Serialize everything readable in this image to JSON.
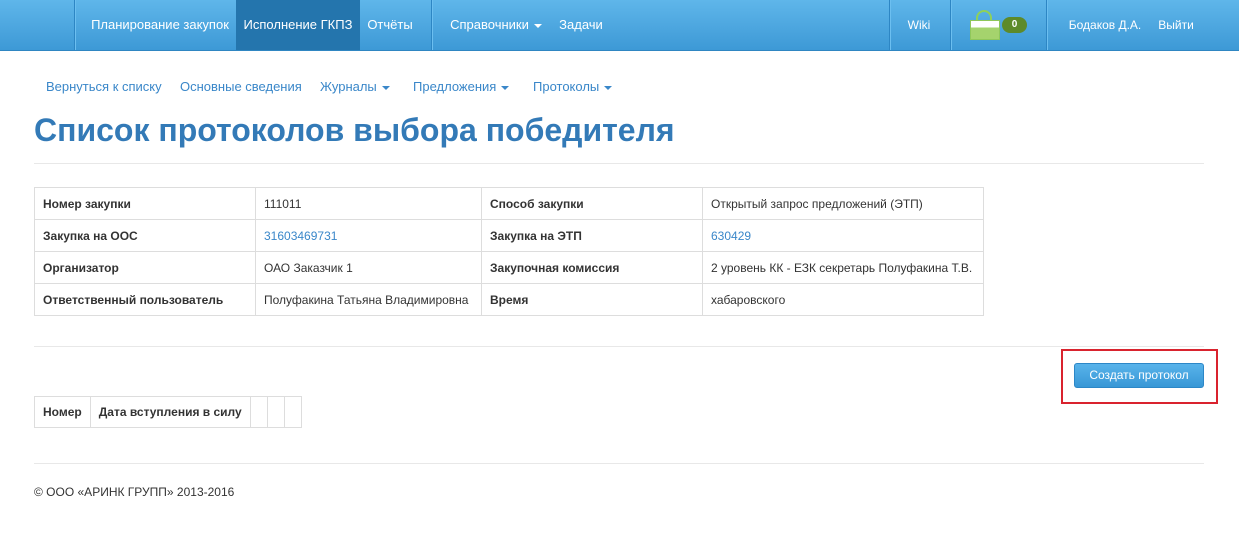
{
  "navbar": {
    "items": [
      {
        "label": "Планирование закупок"
      },
      {
        "label": "Исполнение ГКПЗ"
      },
      {
        "label": "Отчёты"
      },
      {
        "label": "Справочники"
      },
      {
        "label": "Задачи"
      }
    ],
    "wiki": "Wiki",
    "basket_count": "0",
    "user": "Бодаков Д.А.",
    "logout": "Выйти",
    "colors": {
      "bar": "#3d99d6",
      "active": "#2475ad"
    }
  },
  "subnav": {
    "back": "Вернуться к списку",
    "main_info": "Основные сведения",
    "journals": "Журналы",
    "offers": "Предложения",
    "protocols": "Протоколы"
  },
  "page": {
    "title": "Список протоколов выбора победителя"
  },
  "info": {
    "rows": [
      {
        "l1": "Номер закупки",
        "v1": "111011",
        "l2": "Способ закупки",
        "v2": "Открытый запрос предложений (ЭТП)"
      },
      {
        "l1": "Закупка на ООС",
        "v1": "31603469731",
        "l2": "Закупка на ЭТП",
        "v2": "630429"
      },
      {
        "l1": "Организатор",
        "v1": "ОАО Заказчик 1",
        "l2": "Закупочная комиссия",
        "v2": "2 уровень КК - ЕЗК секретарь Полуфакина Т.В."
      },
      {
        "l1": "Ответственный пользователь",
        "v1": "Полуфакина Татьяна Владимировна",
        "l2": "Время",
        "v2": "хабаровского"
      }
    ]
  },
  "actions": {
    "create": "Создать протокол",
    "highlight_color": "#d9232e"
  },
  "protocols_table": {
    "columns": [
      "Номер",
      "Дата вступления в силу"
    ]
  },
  "footer": {
    "copyright": "© ООО «АРИНК ГРУПП» 2013-2016"
  }
}
